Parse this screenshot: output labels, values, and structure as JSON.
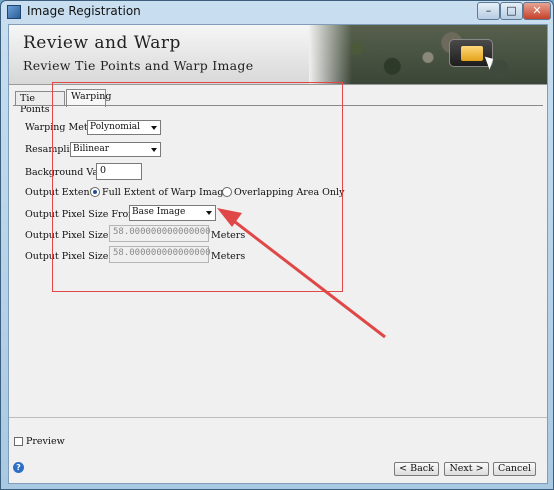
{
  "window": {
    "title": "Image Registration",
    "minimize_glyph": "–",
    "maximize_glyph": "□",
    "close_glyph": "✕"
  },
  "banner": {
    "title": "Review and Warp",
    "subtitle": "Review Tie Points and Warp Image",
    "icon": "folder-icon"
  },
  "tabs": [
    {
      "label": "Tie Points",
      "active": false
    },
    {
      "label": "Warping",
      "active": true
    }
  ],
  "form": {
    "warping_method": {
      "label": "Warping Method",
      "value": "Polynomial"
    },
    "resampling": {
      "label": "Resampling",
      "value": "Bilinear"
    },
    "background_value": {
      "label": "Background Value",
      "value": "0"
    },
    "output_extent": {
      "label": "Output Extent",
      "options": [
        {
          "label": "Full Extent of Warp Image",
          "selected": true
        },
        {
          "label": "Overlapping Area Only",
          "selected": false
        }
      ]
    },
    "output_pixel_size_from": {
      "label": "Output Pixel Size From",
      "value": "Base Image"
    },
    "output_pixel_size_x": {
      "label": "Output Pixel Size X",
      "value": "58.000000000000000",
      "unit": "Meters"
    },
    "output_pixel_size_y": {
      "label": "Output Pixel Size Y",
      "value": "58.000000000000000",
      "unit": "Meters"
    }
  },
  "footer": {
    "preview_label": "Preview",
    "preview_checked": false,
    "back_label": "< Back",
    "next_label": "Next >",
    "cancel_label": "Cancel"
  },
  "colors": {
    "annotation_red": "#e04848",
    "title_bar": "#a9c8e2"
  }
}
